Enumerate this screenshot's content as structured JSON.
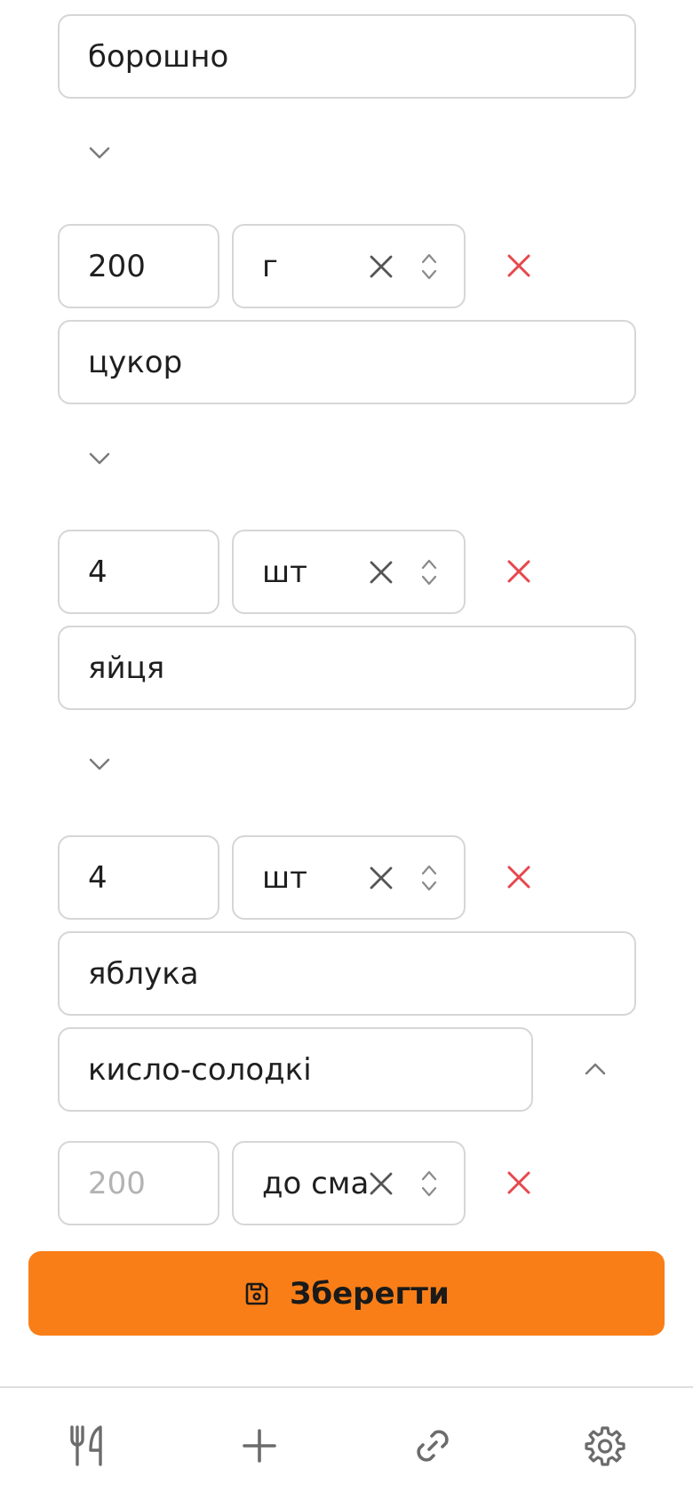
{
  "ingredients": {
    "first_name": "борошно",
    "rows": [
      {
        "amount": "200",
        "unit": "г",
        "name": "цукор"
      },
      {
        "amount": "4",
        "unit": "шт",
        "name": "яйця"
      },
      {
        "amount": "4",
        "unit": "шт",
        "name": "яблука",
        "note": "кисло-солодкі"
      }
    ],
    "new_row": {
      "amount_placeholder": "200",
      "unit": "до смаку"
    }
  },
  "save_button": {
    "label": "Зберегти",
    "color": "#fa7e17"
  },
  "bottom_nav": {
    "items": [
      {
        "icon": "utensils-icon"
      },
      {
        "icon": "plus-icon"
      },
      {
        "icon": "link-icon"
      },
      {
        "icon": "gear-icon"
      }
    ]
  },
  "colors": {
    "remove": "#e5484d",
    "border": "#d6d6d6",
    "icon_gray": "#555555"
  }
}
